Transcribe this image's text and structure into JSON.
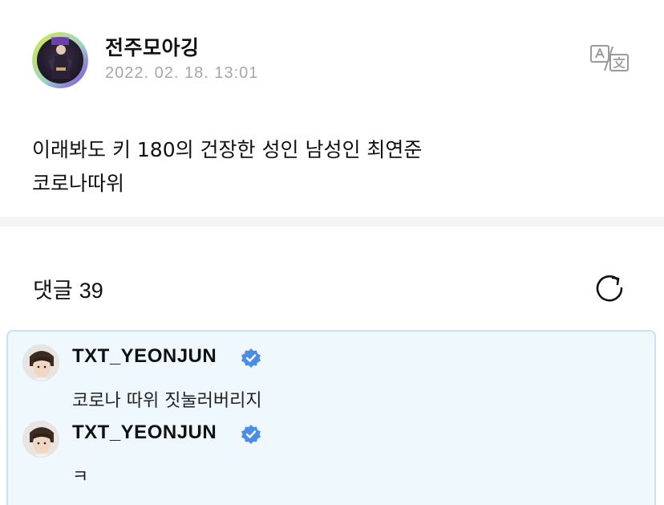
{
  "post": {
    "author_name": "전주모아깅",
    "timestamp": "2022. 02. 18. 13:01",
    "body_lines": [
      "이래봐도 키 180의 건장한 성인 남성인 최연준",
      "코로나따위"
    ],
    "translate_icon": "translate-icon"
  },
  "comments_section": {
    "title": "댓글",
    "count": "39",
    "refresh_icon": "refresh-icon"
  },
  "comments": [
    {
      "author": "TXT_YEONJUN",
      "verified": true,
      "text": "코로나 따위 짓눌러버리지"
    },
    {
      "author": "TXT_YEONJUN",
      "verified": true,
      "text": "ㅋ"
    }
  ],
  "colors": {
    "verified_badge": "#4a8de8",
    "comment_highlight_bg": "#eef8fd",
    "comment_highlight_border": "#c8e2f0",
    "avatar_ring_start": "#c8e63c",
    "avatar_ring_end": "#8a4fe0",
    "timestamp": "#a7a7a7"
  }
}
